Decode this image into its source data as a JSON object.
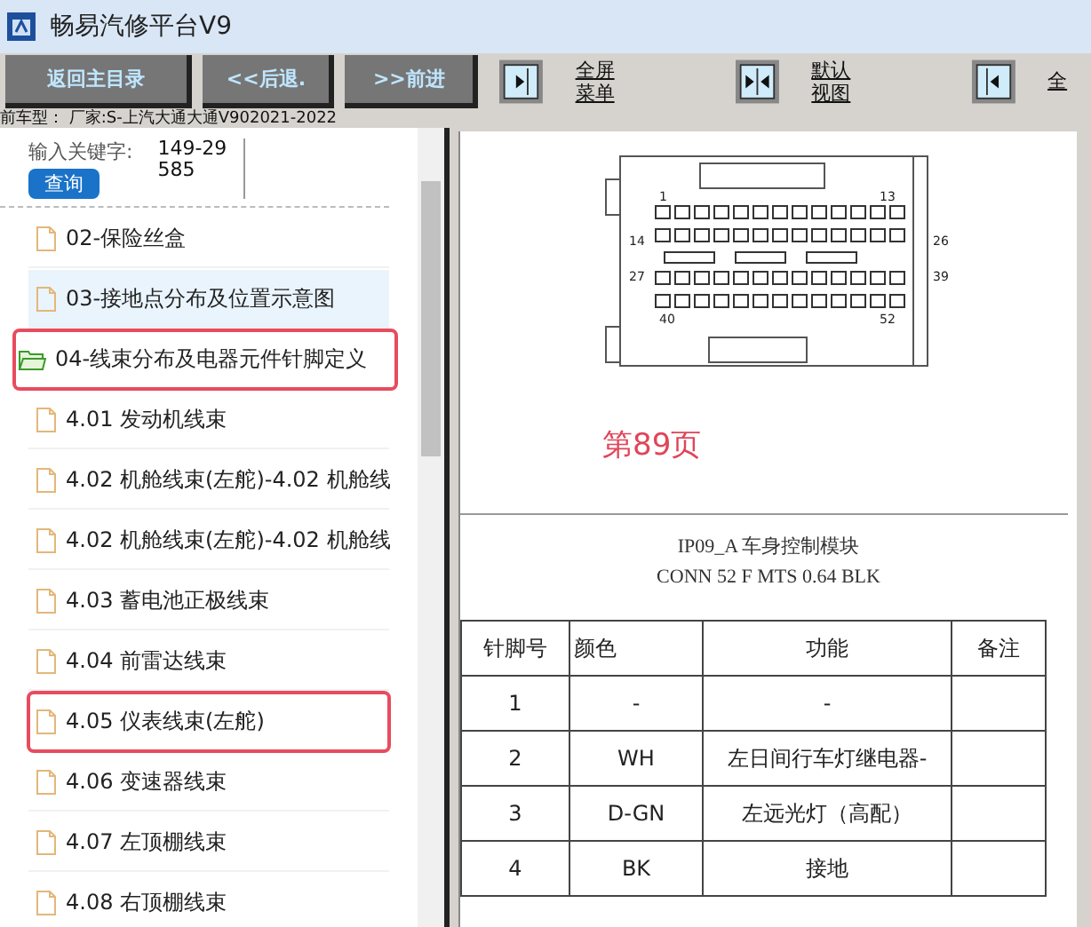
{
  "window": {
    "title": "畅易汽修平台V9"
  },
  "toolbar": {
    "buttons": [
      "返回主目录",
      "<<后退.",
      ">>前进"
    ],
    "view_buttons": [
      {
        "kind": "right",
        "label": "全屏菜单"
      },
      {
        "kind": "both",
        "label": "默认视图"
      },
      {
        "kind": "left",
        "label": "全"
      }
    ]
  },
  "car_model": "前车型： 厂家:S-上汽大通大通V902021-2022",
  "search": {
    "label": "输入关键字:",
    "value": "149-29585",
    "button": "查询"
  },
  "tree": [
    {
      "label": "02-保险丝盒",
      "kind": "file",
      "selected": false,
      "marked": false
    },
    {
      "label": "03-接地点分布及位置示意图",
      "kind": "file",
      "selected": true,
      "marked": false
    },
    {
      "label": "04-线束分布及电器元件针脚定义",
      "kind": "folder",
      "selected": false,
      "marked": true,
      "children": [
        {
          "label": "4.01 发动机线束",
          "kind": "file",
          "selected": false,
          "marked": false
        },
        {
          "label": "4.02 机舱线束(左舵)-4.02 机舱线",
          "kind": "file",
          "selected": false,
          "marked": false
        },
        {
          "label": "4.02 机舱线束(左舵)-4.02 机舱线",
          "kind": "file",
          "selected": false,
          "marked": false
        },
        {
          "label": "4.03 蓄电池正极线束",
          "kind": "file",
          "selected": false,
          "marked": false
        },
        {
          "label": "4.04 前雷达线束",
          "kind": "file",
          "selected": false,
          "marked": false
        },
        {
          "label": "4.05 仪表线束(左舵)",
          "kind": "file",
          "selected": false,
          "marked": true
        },
        {
          "label": "4.06 变速器线束",
          "kind": "file",
          "selected": false,
          "marked": false
        },
        {
          "label": "4.07 左顶棚线束",
          "kind": "file",
          "selected": false,
          "marked": false
        },
        {
          "label": "4.08 右顶棚线束",
          "kind": "file",
          "selected": false,
          "marked": false
        }
      ]
    }
  ],
  "document": {
    "pin_labels": [
      "1",
      "13",
      "14",
      "26",
      "27",
      "39",
      "40",
      "52"
    ],
    "page_label": "第89页",
    "connector_title": "IP09_A 车身控制模块",
    "connector_spec": "CONN 52 F MTS 0.64 BLK",
    "table": {
      "columns": [
        "针脚号",
        "颜色",
        "功能",
        "备注"
      ],
      "rows": [
        [
          "1",
          "-",
          "-",
          ""
        ],
        [
          "2",
          "WH",
          "左日间行车灯继电器-",
          ""
        ],
        [
          "3",
          "D-GN",
          "左远光灯（高配）",
          ""
        ],
        [
          "4",
          "BK",
          "接地",
          ""
        ]
      ]
    }
  }
}
